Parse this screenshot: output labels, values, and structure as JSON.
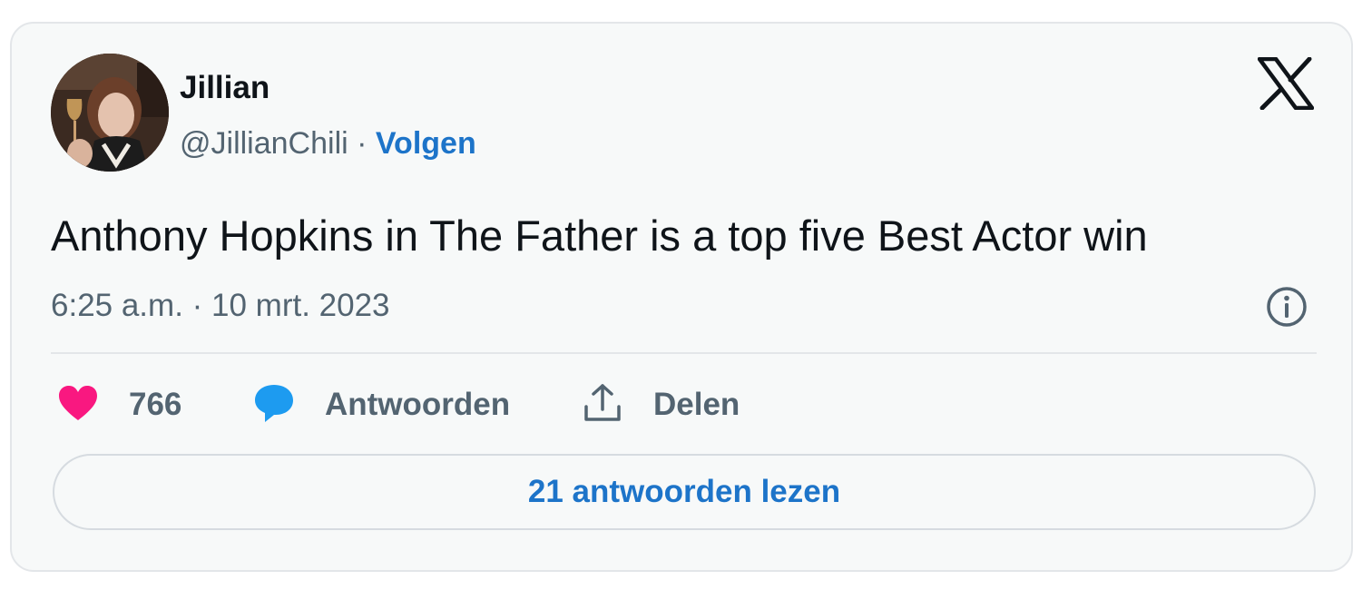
{
  "author": {
    "display_name": "Jillian",
    "handle": "@JillianChili",
    "separator": "·",
    "follow_label": "Volgen",
    "avatar_icon": "profile-photo"
  },
  "platform": {
    "logo_icon": "x-logo-icon"
  },
  "tweet": {
    "text": "Anthony Hopkins in The Father is a top five Best Actor win",
    "timestamp": "6:25 a.m. · 10 mrt. 2023",
    "info_icon": "info-icon"
  },
  "actions": {
    "like_count": "766",
    "like_icon": "heart-icon",
    "reply_label": "Antwoorden",
    "reply_icon": "speech-bubble-icon",
    "share_label": "Delen",
    "share_icon": "share-upload-icon"
  },
  "footer": {
    "read_replies_label": "21 antwoorden lezen"
  },
  "colors": {
    "like": "#f91880",
    "reply": "#1d9bf0",
    "link": "#1d74c9",
    "muted": "#536471",
    "text": "#0f1419",
    "card_background": "#f7f9f9"
  }
}
